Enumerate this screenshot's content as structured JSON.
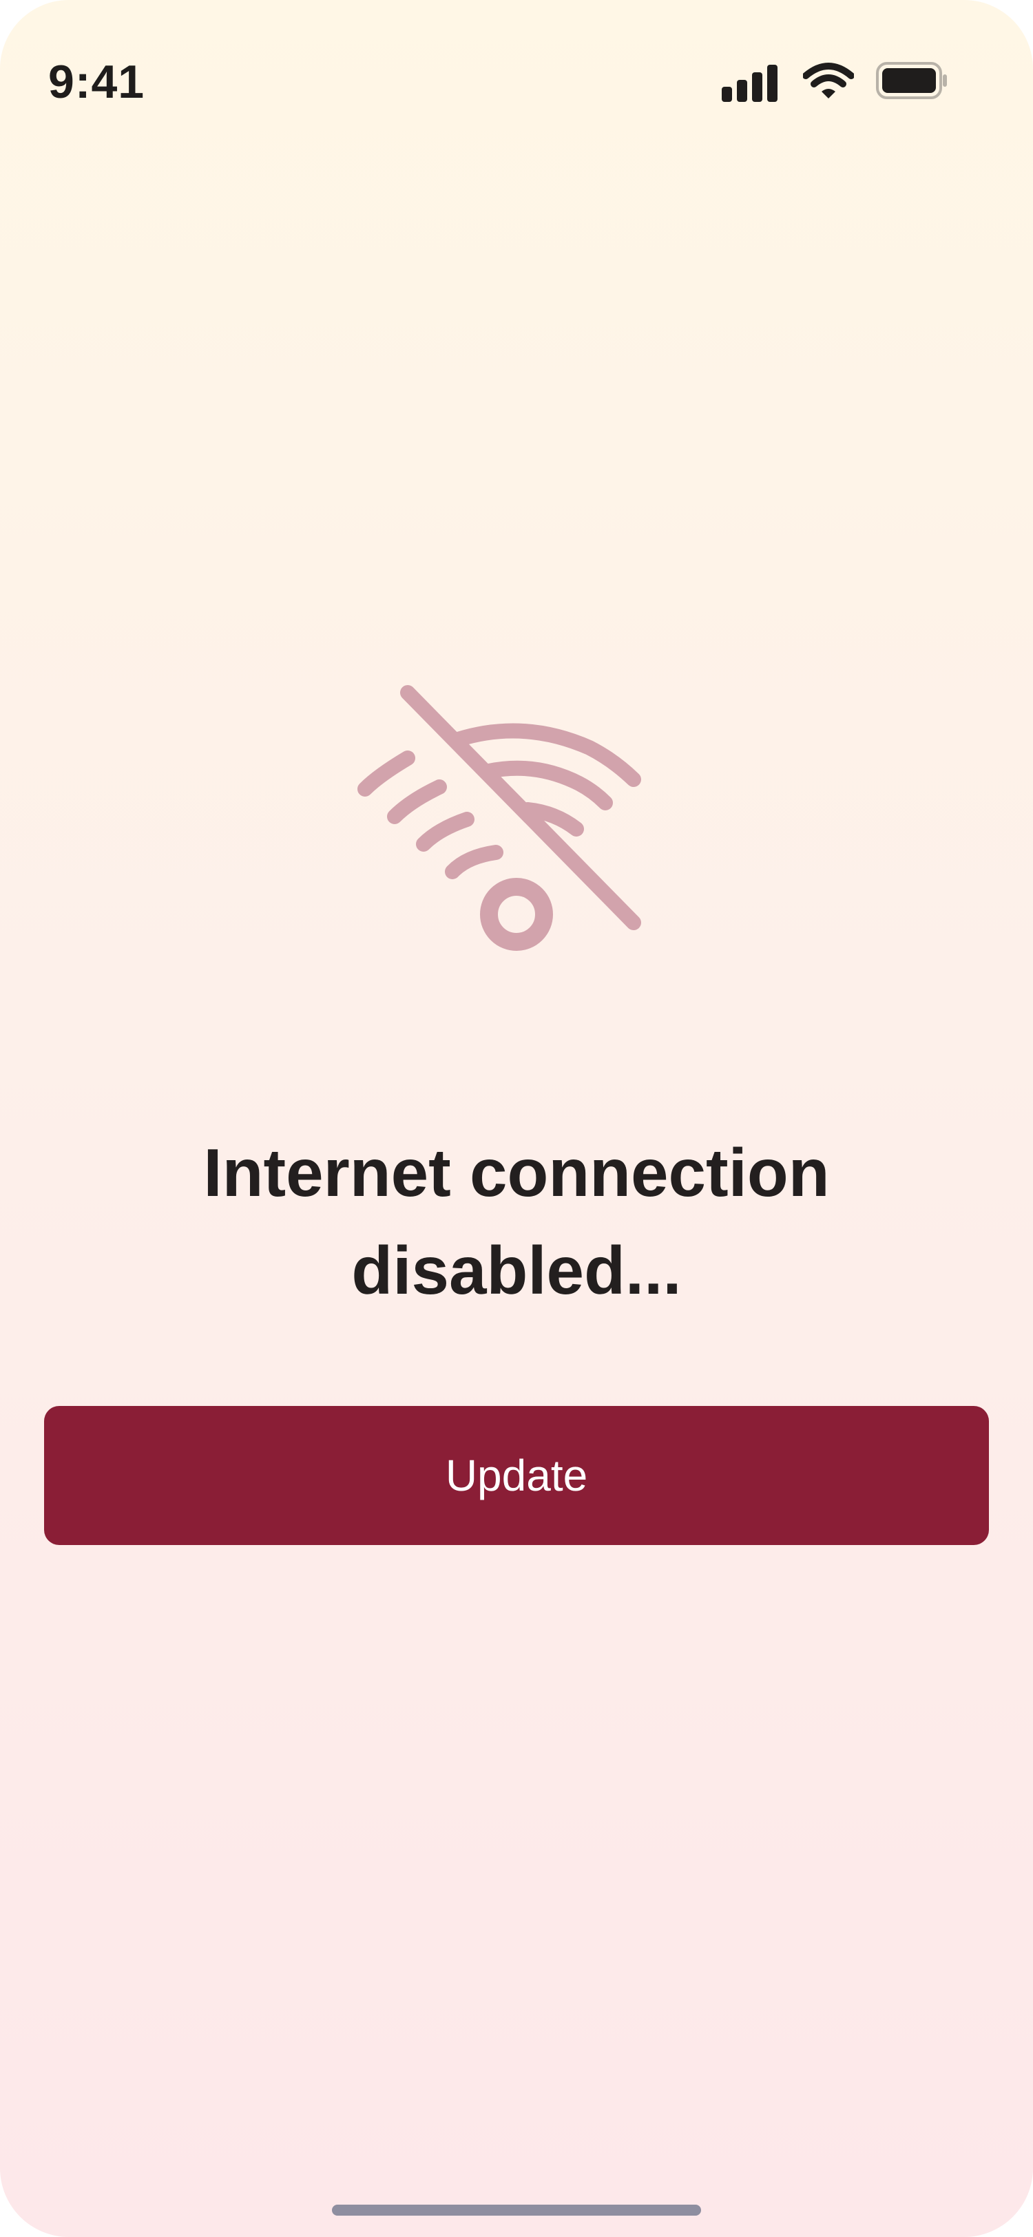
{
  "status_bar": {
    "time": "9:41",
    "icons": [
      "cellular-signal-icon",
      "wifi-icon",
      "battery-icon"
    ]
  },
  "main": {
    "icon": "wifi-off-icon",
    "message_line1": "Internet connection",
    "message_line2": "disabled...",
    "button_label": "Update"
  },
  "colors": {
    "accent": "#8a1e36",
    "icon": "#d2a3ac",
    "text": "#231f1f",
    "background_top": "#fff7e6",
    "background_bottom": "#fde8ea"
  }
}
